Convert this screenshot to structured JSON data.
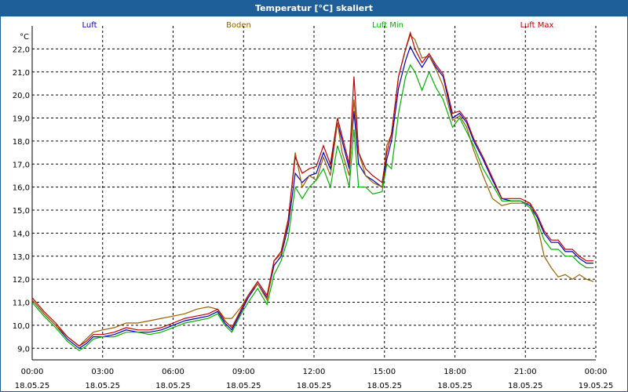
{
  "window": {
    "title": "Temperatur [°C] skaliert"
  },
  "chart_data": {
    "type": "line",
    "title": "Temperatur [°C] skaliert",
    "ylabel": "°C",
    "ylim": [
      8.5,
      23.0
    ],
    "xlim": [
      0,
      24
    ],
    "grid": true,
    "legend_placement": "top",
    "y_ticks": [
      "9,0",
      "10,0",
      "11,0",
      "12,0",
      "13,0",
      "14,0",
      "15,0",
      "16,0",
      "17,0",
      "18,0",
      "19,0",
      "20,0",
      "21,0",
      "22,0"
    ],
    "x_ticks": [
      {
        "time": "00:00",
        "date": "18.05.25"
      },
      {
        "time": "03:00",
        "date": "18.05.25"
      },
      {
        "time": "06:00",
        "date": "18.05.25"
      },
      {
        "time": "09:00",
        "date": "18.05.25"
      },
      {
        "time": "12:00",
        "date": "18.05.25"
      },
      {
        "time": "15:00",
        "date": "18.05.25"
      },
      {
        "time": "18:00",
        "date": "18.05.25"
      },
      {
        "time": "21:00",
        "date": "18.05.25"
      },
      {
        "time": "00:00",
        "date": "19.05.25"
      }
    ],
    "series": [
      {
        "name": "Luft",
        "color": "#0000c0",
        "x": [
          0,
          0.5,
          1,
          1.5,
          2,
          2.3,
          2.6,
          3,
          3.5,
          4,
          4.5,
          5,
          5.5,
          6,
          6.5,
          7,
          7.5,
          7.9,
          8.2,
          8.5,
          8.9,
          9.2,
          9.6,
          10,
          10.3,
          10.6,
          10.9,
          11.2,
          11.5,
          11.8,
          12.1,
          12.4,
          12.7,
          13,
          13.2,
          13.5,
          13.7,
          13.9,
          14.2,
          14.5,
          14.9,
          15.1,
          15.3,
          15.6,
          15.9,
          16.1,
          16.3,
          16.6,
          16.9,
          17.2,
          17.5,
          17.9,
          18.2,
          18.5,
          18.8,
          19.2,
          19.6,
          20,
          20.4,
          20.8,
          21.2,
          21.5,
          21.8,
          22.1,
          22.4,
          22.7,
          23,
          23.3,
          23.6,
          23.9
        ],
        "values": [
          11.1,
          10.5,
          10.0,
          9.4,
          9.0,
          9.2,
          9.5,
          9.5,
          9.6,
          9.8,
          9.7,
          9.7,
          9.8,
          10.0,
          10.2,
          10.3,
          10.4,
          10.6,
          10.1,
          9.8,
          10.6,
          11.2,
          11.8,
          11.2,
          12.6,
          13.0,
          14.3,
          16.6,
          16.2,
          16.5,
          16.6,
          17.5,
          16.8,
          18.8,
          18.0,
          16.8,
          19.3,
          17.0,
          16.5,
          16.3,
          16.0,
          17.2,
          18.0,
          20.3,
          21.5,
          22.1,
          21.7,
          21.2,
          21.7,
          21.2,
          20.8,
          19.0,
          19.2,
          18.8,
          18.0,
          17.2,
          16.3,
          15.5,
          15.4,
          15.4,
          15.2,
          14.7,
          14.0,
          13.6,
          13.6,
          13.2,
          13.2,
          12.9,
          12.7,
          12.7
        ]
      },
      {
        "name": "Boden",
        "color": "#9b5f00",
        "x": [
          0,
          0.5,
          1,
          1.5,
          2,
          2.3,
          2.6,
          3,
          3.5,
          4,
          4.5,
          5,
          5.5,
          6,
          6.5,
          7,
          7.5,
          7.9,
          8.2,
          8.5,
          8.9,
          9.2,
          9.6,
          10,
          10.3,
          10.6,
          10.9,
          11.2,
          11.5,
          11.8,
          12.1,
          12.4,
          12.7,
          13,
          13.2,
          13.5,
          13.7,
          13.9,
          14.2,
          14.5,
          14.9,
          15.1,
          15.3,
          15.6,
          15.9,
          16.1,
          16.3,
          16.6,
          16.9,
          17.2,
          17.5,
          17.9,
          18.2,
          18.5,
          18.8,
          19.2,
          19.6,
          20,
          20.4,
          20.8,
          21.2,
          21.5,
          21.8,
          22.1,
          22.4,
          22.7,
          23,
          23.3,
          23.6,
          23.9
        ],
        "values": [
          11.1,
          10.5,
          10.0,
          9.5,
          9.1,
          9.4,
          9.7,
          9.8,
          9.9,
          10.1,
          10.1,
          10.2,
          10.3,
          10.4,
          10.5,
          10.7,
          10.8,
          10.7,
          10.3,
          10.3,
          10.8,
          11.3,
          11.8,
          11.1,
          12.8,
          13.1,
          14.5,
          17.5,
          16.0,
          16.5,
          16.3,
          17.3,
          16.5,
          18.8,
          17.5,
          16.5,
          19.8,
          17.5,
          16.5,
          16.2,
          16.0,
          17.8,
          18.3,
          20.8,
          22.0,
          22.6,
          22.4,
          21.6,
          21.7,
          21.1,
          20.4,
          18.9,
          19.1,
          18.6,
          17.6,
          16.5,
          15.5,
          15.2,
          15.3,
          15.3,
          15.3,
          14.4,
          13.0,
          12.5,
          12.1,
          12.2,
          12.0,
          12.2,
          12.0,
          11.9
        ]
      },
      {
        "name": "Luft Min",
        "color": "#00b400",
        "x": [
          0,
          0.5,
          1,
          1.5,
          2,
          2.3,
          2.6,
          3,
          3.5,
          4,
          4.5,
          5,
          5.5,
          6,
          6.5,
          7,
          7.5,
          7.9,
          8.2,
          8.5,
          8.9,
          9.2,
          9.6,
          10,
          10.3,
          10.6,
          10.9,
          11.2,
          11.5,
          11.8,
          12.1,
          12.4,
          12.7,
          13,
          13.2,
          13.5,
          13.7,
          13.9,
          14.2,
          14.5,
          14.9,
          15.1,
          15.3,
          15.6,
          15.9,
          16.1,
          16.3,
          16.6,
          16.9,
          17.2,
          17.5,
          17.9,
          18.2,
          18.5,
          18.8,
          19.2,
          19.6,
          20,
          20.4,
          20.8,
          21.2,
          21.5,
          21.8,
          22.1,
          22.4,
          22.7,
          23,
          23.3,
          23.6,
          23.9
        ],
        "values": [
          11.0,
          10.4,
          9.9,
          9.3,
          8.9,
          9.1,
          9.4,
          9.5,
          9.5,
          9.7,
          9.7,
          9.6,
          9.7,
          9.9,
          10.1,
          10.2,
          10.3,
          10.5,
          10.0,
          9.7,
          10.5,
          11.0,
          11.6,
          10.9,
          12.2,
          12.8,
          13.8,
          16.0,
          15.5,
          16.0,
          16.3,
          16.8,
          16.0,
          17.8,
          17.2,
          16.0,
          18.5,
          16.0,
          16.0,
          15.7,
          15.8,
          17.0,
          16.8,
          19.2,
          20.8,
          21.3,
          21.0,
          20.2,
          21.0,
          20.3,
          19.8,
          18.6,
          19.0,
          18.4,
          17.8,
          16.8,
          16.1,
          15.4,
          15.4,
          15.4,
          15.1,
          14.5,
          13.7,
          13.3,
          13.3,
          13.0,
          13.0,
          12.7,
          12.5,
          12.5
        ]
      },
      {
        "name": "Luft Max",
        "color": "#c00000",
        "x": [
          0,
          0.5,
          1,
          1.5,
          2,
          2.3,
          2.6,
          3,
          3.5,
          4,
          4.5,
          5,
          5.5,
          6,
          6.5,
          7,
          7.5,
          7.9,
          8.2,
          8.5,
          8.9,
          9.2,
          9.6,
          10,
          10.3,
          10.6,
          10.9,
          11.2,
          11.5,
          11.8,
          12.1,
          12.4,
          12.7,
          13,
          13.2,
          13.5,
          13.7,
          13.9,
          14.2,
          14.5,
          14.9,
          15.1,
          15.3,
          15.6,
          15.9,
          16.1,
          16.3,
          16.6,
          16.9,
          17.2,
          17.5,
          17.9,
          18.2,
          18.5,
          18.8,
          19.2,
          19.6,
          20,
          20.4,
          20.8,
          21.2,
          21.5,
          21.8,
          22.1,
          22.4,
          22.7,
          23,
          23.3,
          23.6,
          23.9
        ],
        "values": [
          11.2,
          10.6,
          10.1,
          9.5,
          9.1,
          9.3,
          9.6,
          9.6,
          9.7,
          9.9,
          9.8,
          9.8,
          9.9,
          10.1,
          10.3,
          10.4,
          10.5,
          10.7,
          10.2,
          9.9,
          10.7,
          11.3,
          11.9,
          11.3,
          12.8,
          13.2,
          14.6,
          17.3,
          16.6,
          16.8,
          16.9,
          17.8,
          17.0,
          19.0,
          18.2,
          17.0,
          20.8,
          17.5,
          16.8,
          16.5,
          16.2,
          17.5,
          18.3,
          20.8,
          22.0,
          22.7,
          22.0,
          21.4,
          21.8,
          21.3,
          20.9,
          19.2,
          19.3,
          18.9,
          18.1,
          17.3,
          16.4,
          15.5,
          15.5,
          15.5,
          15.3,
          14.8,
          14.1,
          13.7,
          13.7,
          13.3,
          13.3,
          13.0,
          12.8,
          12.8
        ]
      }
    ]
  }
}
